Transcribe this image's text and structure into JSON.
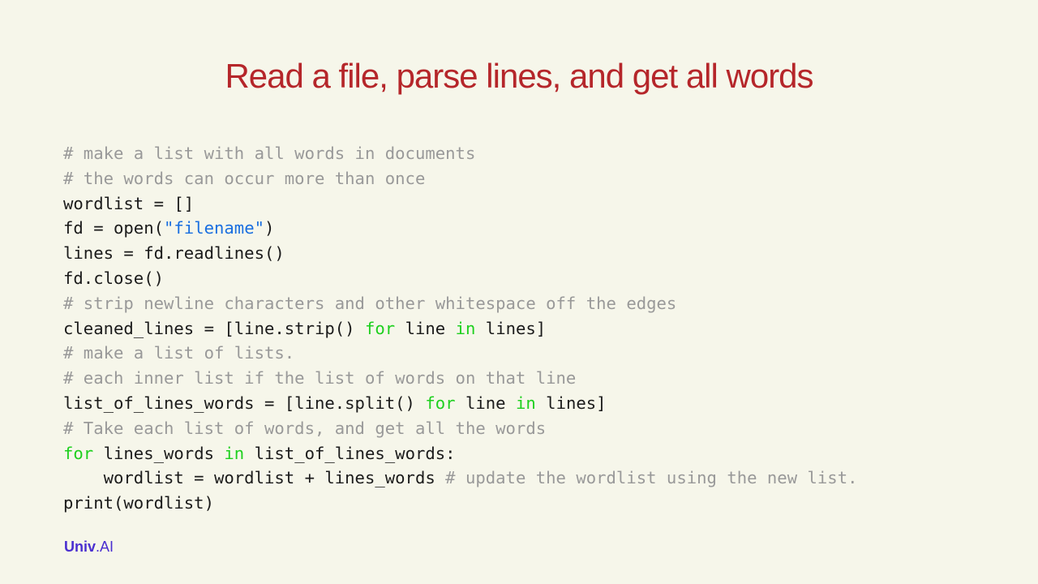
{
  "slide": {
    "title": "Read a file, parse lines, and get all words"
  },
  "colors": {
    "background": "#f6f6ea",
    "title": "#b5262a",
    "comment": "#999999",
    "string": "#1a6fe0",
    "keyword": "#1fd01f",
    "text": "#1b1b1b",
    "logo": "#4a2fd0"
  },
  "code": {
    "language": "python",
    "lines": [
      [
        {
          "t": "comment",
          "v": "# make a list with all words in documents"
        }
      ],
      [
        {
          "t": "comment",
          "v": "# the words can occur more than once"
        }
      ],
      [
        {
          "t": "plain",
          "v": "wordlist = []"
        }
      ],
      [
        {
          "t": "plain",
          "v": "fd = open("
        },
        {
          "t": "string",
          "v": "\"filename\""
        },
        {
          "t": "plain",
          "v": ")"
        }
      ],
      [
        {
          "t": "plain",
          "v": "lines = fd.readlines()"
        }
      ],
      [
        {
          "t": "plain",
          "v": "fd.close()"
        }
      ],
      [
        {
          "t": "comment",
          "v": "# strip newline characters and other whitespace off the edges"
        }
      ],
      [
        {
          "t": "plain",
          "v": "cleaned_lines = [line.strip() "
        },
        {
          "t": "keyword",
          "v": "for"
        },
        {
          "t": "plain",
          "v": " line "
        },
        {
          "t": "keyword",
          "v": "in"
        },
        {
          "t": "plain",
          "v": " lines]"
        }
      ],
      [
        {
          "t": "comment",
          "v": "# make a list of lists."
        }
      ],
      [
        {
          "t": "comment",
          "v": "# each inner list if the list of words on that line"
        }
      ],
      [
        {
          "t": "plain",
          "v": "list_of_lines_words = [line.split() "
        },
        {
          "t": "keyword",
          "v": "for"
        },
        {
          "t": "plain",
          "v": " line "
        },
        {
          "t": "keyword",
          "v": "in"
        },
        {
          "t": "plain",
          "v": " lines]"
        }
      ],
      [
        {
          "t": "comment",
          "v": "# Take each list of words, and get all the words"
        }
      ],
      [
        {
          "t": "keyword",
          "v": "for"
        },
        {
          "t": "plain",
          "v": " lines_words "
        },
        {
          "t": "keyword",
          "v": "in"
        },
        {
          "t": "plain",
          "v": " list_of_lines_words:"
        }
      ],
      [
        {
          "t": "plain",
          "v": "    wordlist = wordlist + lines_words "
        },
        {
          "t": "comment",
          "v": "# update the wordlist using the new list."
        }
      ],
      [
        {
          "t": "plain",
          "v": "print(wordlist)"
        }
      ]
    ]
  },
  "logo": {
    "univ": "Univ",
    "ai": ".AI"
  }
}
